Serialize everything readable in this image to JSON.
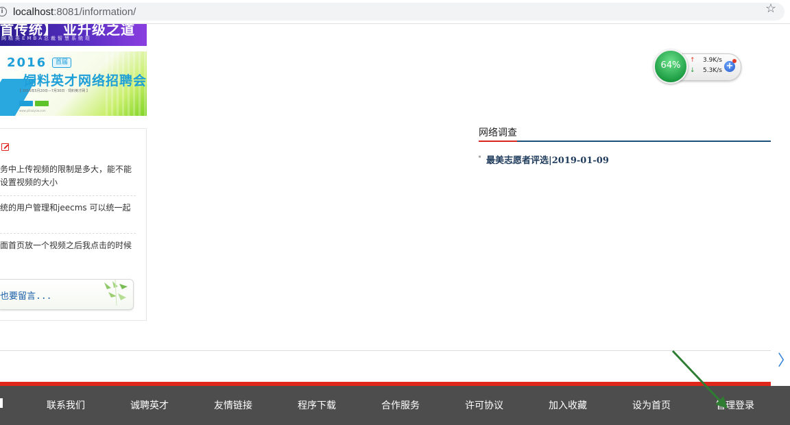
{
  "browser": {
    "url_host": "localhost",
    "url_port_path": ":8081/information/",
    "info_icon": "info-icon",
    "bookmark_icon": "star-icon"
  },
  "banner_top": {
    "title": "首传统】 业升级之道",
    "subtitle": "网精英EMBA总裁智慧系统班"
  },
  "banner_recruit": {
    "year": "2016",
    "tag": "首届",
    "title": "饲料英才网络招聘会",
    "date": "【 2016年5月20日—7月30日 · 饲料英才网 】",
    "small": "www.yiliaoycw.com"
  },
  "message_board": {
    "icon": "edit-icon",
    "items": [
      "务中上传视频的限制是多大，能不能设置视频的大小",
      "统的用户管理和jeecms  可以统一起",
      "面首页放一个视频之后我点击的时候"
    ],
    "leave_message_label": "也要留言..."
  },
  "net_widget": {
    "percent": "64%",
    "upload": "3.9K/s",
    "download": "5.3K/s",
    "up_arrow": "↑",
    "down_arrow": "↓",
    "plus": "+"
  },
  "survey": {
    "title": "网络调查",
    "items": [
      "最美志愿者评选|2019-01-09"
    ]
  },
  "next_icon": "chevron-right-icon",
  "footer_nav": {
    "items": [
      "联系我们",
      "诚聘英才",
      "友情链接",
      "程序下载",
      "合作服务",
      "许可协议",
      "加入收藏",
      "设为首页",
      "管理登录"
    ]
  },
  "colors": {
    "accent_red": "#e0251b",
    "nav_bg": "#4d4d4d",
    "survey_blue": "#1f4e79",
    "link_blue": "#1a5fa8",
    "arrow_green": "#2e7d32"
  }
}
